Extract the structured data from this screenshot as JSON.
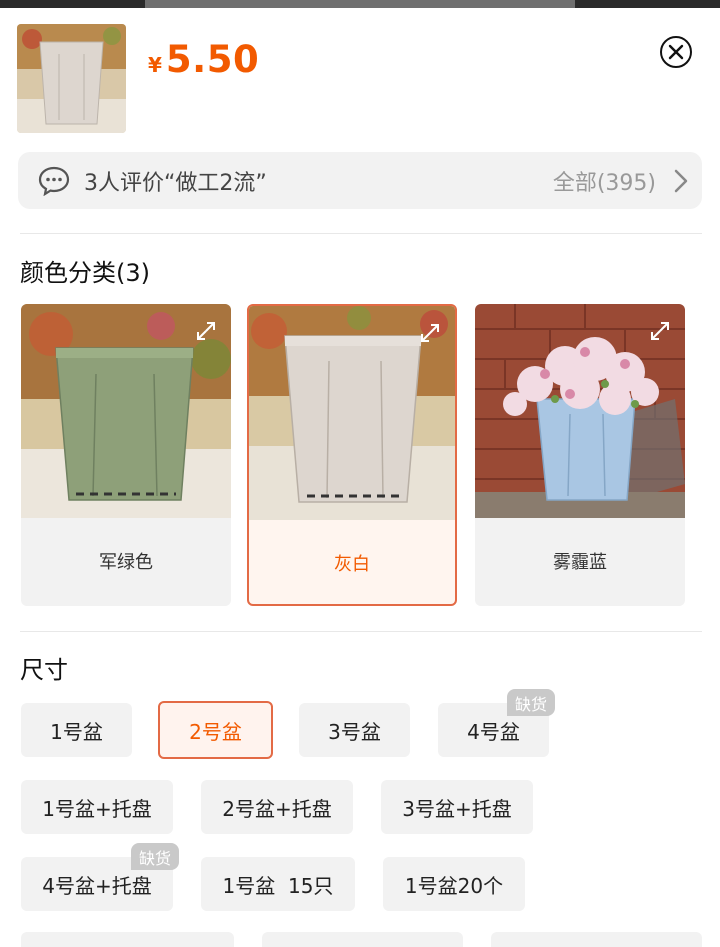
{
  "product": {
    "currency_symbol": "¥",
    "price": "5.50"
  },
  "review": {
    "text": "3人评价“做工2流”",
    "all_label": "全部(395)"
  },
  "color_section": {
    "title": "颜色分类(3)",
    "options": [
      {
        "label": "军绿色",
        "selected": false
      },
      {
        "label": "灰白",
        "selected": true
      },
      {
        "label": "雾霾蓝",
        "selected": false
      }
    ]
  },
  "size_section": {
    "title": "尺寸",
    "options": [
      {
        "label": "1号盆",
        "selected": false
      },
      {
        "label": "2号盆",
        "selected": true
      },
      {
        "label": "3号盆",
        "selected": false
      },
      {
        "label": "4号盆",
        "selected": false,
        "badge": "缺货"
      },
      {
        "label": "1号盆+托盘",
        "selected": false
      },
      {
        "label": "2号盆+托盘",
        "selected": false
      },
      {
        "label": "3号盆+托盘",
        "selected": false
      },
      {
        "label": "4号盆+托盘",
        "selected": false,
        "badge": "缺货"
      },
      {
        "label": "1号盆  15只",
        "selected": false
      },
      {
        "label": "1号盆20个",
        "selected": false
      }
    ]
  },
  "colors": {
    "accent": "#f25a00",
    "selected_border": "#e36a45",
    "chip_bg": "#f2f2f2"
  }
}
